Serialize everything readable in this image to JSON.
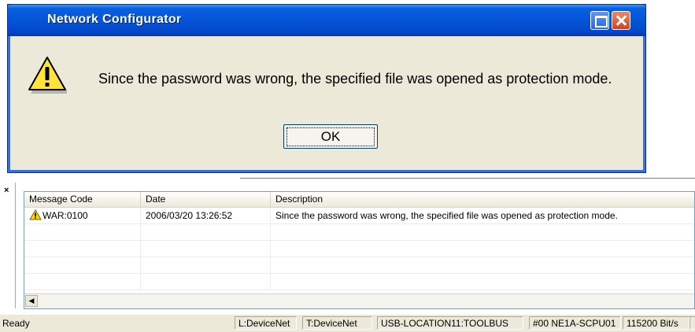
{
  "dialog": {
    "title": "Network Configurator",
    "message": "Since the password was wrong, the specified file was opened as protection mode.",
    "ok_label": "OK",
    "icon": "warning-icon"
  },
  "log": {
    "close_glyph": "×",
    "columns": [
      "Message Code",
      "Date",
      "Description"
    ],
    "rows": [
      {
        "code": "WAR:0100",
        "date": "2006/03/20 13:26:52",
        "description": "Since the password was wrong, the specified file was opened as protection mode."
      }
    ],
    "scroll_left_glyph": "◀"
  },
  "status": {
    "ready": "Ready",
    "panel1": "L:DeviceNet",
    "panel2": "T:DeviceNet",
    "panel3": "USB-LOCATION11:TOOLBUS",
    "panel4": "#00 NE1A-SCPU01",
    "panel5": "115200 Bit/s"
  },
  "colors": {
    "titlebar": "#0554d8",
    "dialog_bg": "#ece9d8",
    "warning": "#ffd800"
  }
}
